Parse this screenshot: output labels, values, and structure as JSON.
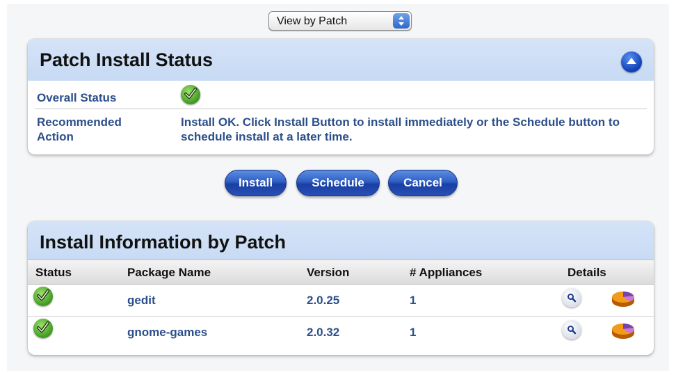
{
  "view_select": {
    "value": "View by Patch"
  },
  "status_panel": {
    "title": "Patch Install Status",
    "rows": [
      {
        "key": "Overall Status",
        "value": ""
      },
      {
        "key": "Recommended Action",
        "value": "Install OK. Click Install Button to install immediately or the Schedule button to schedule install at a later time."
      }
    ]
  },
  "actions": {
    "install": "Install",
    "schedule": "Schedule",
    "cancel": "Cancel"
  },
  "table_panel": {
    "title": "Install Information by Patch",
    "columns": [
      "Status",
      "Package Name",
      "Version",
      "# Appliances",
      "Details"
    ],
    "rows": [
      {
        "package": "gedit",
        "version": "2.0.25",
        "appliances": "1"
      },
      {
        "package": "gnome-games",
        "version": "2.0.32",
        "appliances": "1"
      }
    ]
  },
  "icons": {
    "status": "green-check-icon",
    "details": "magnifier-icon",
    "chart": "pie-chart-icon"
  },
  "colors": {
    "header_bg": "#c7daf4",
    "link_text": "#2c4f8a",
    "button_blue": "#2f5fc5",
    "status_green": "#3f9a1e"
  }
}
